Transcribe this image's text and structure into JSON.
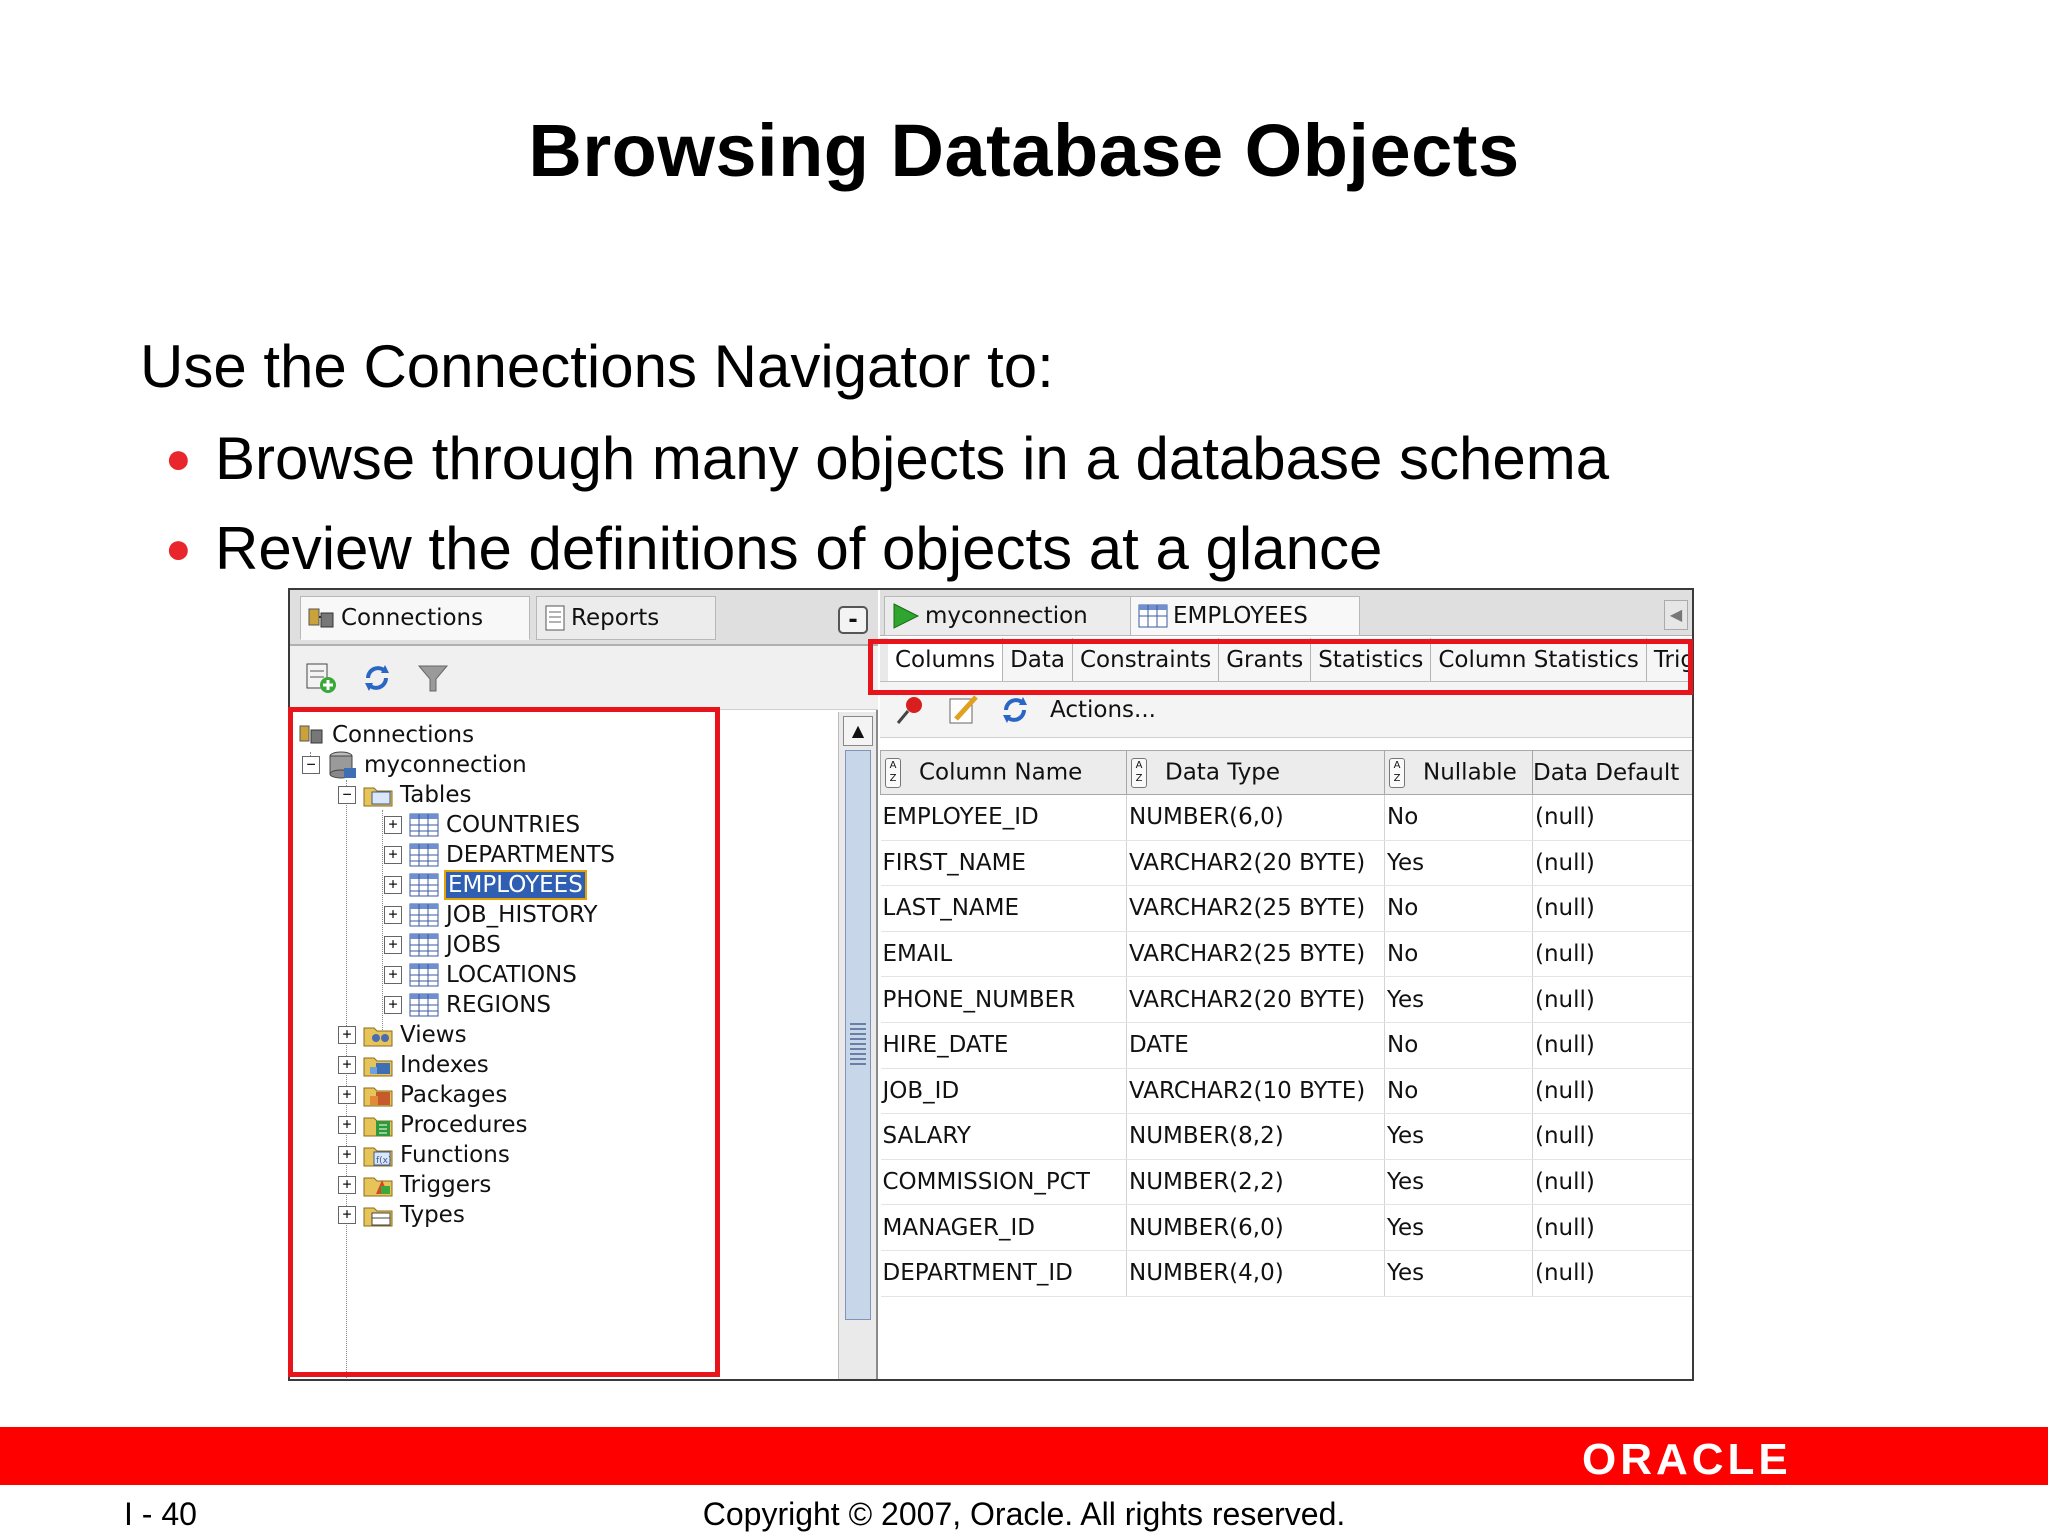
{
  "slide": {
    "title": "Browsing Database Objects",
    "intro": "Use the Connections Navigator to:",
    "bullets": [
      "Browse through many objects in a database schema",
      "Review the definitions of objects at a glance"
    ]
  },
  "left_pane": {
    "tabs": [
      "Connections",
      "Reports"
    ],
    "minimize": "-",
    "tree": {
      "root": "Connections",
      "connection": "myconnection",
      "tables_label": "Tables",
      "tables": [
        "COUNTRIES",
        "DEPARTMENTS",
        "EMPLOYEES",
        "JOB_HISTORY",
        "JOBS",
        "LOCATIONS",
        "REGIONS"
      ],
      "folders": [
        "Views",
        "Indexes",
        "Packages",
        "Procedures",
        "Functions",
        "Triggers",
        "Types"
      ]
    }
  },
  "right_pane": {
    "doc_tabs": [
      "myconnection",
      "EMPLOYEES"
    ],
    "subtabs": [
      "Columns",
      "Data",
      "Constraints",
      "Grants",
      "Statistics",
      "Column Statistics",
      "Trig"
    ],
    "actions_label": "Actions...",
    "grid": {
      "headers": [
        "Column Name",
        "Data Type",
        "Nullable",
        "Data Default"
      ],
      "rows": [
        [
          "EMPLOYEE_ID",
          "NUMBER(6,0)",
          "No",
          "(null)"
        ],
        [
          "FIRST_NAME",
          "VARCHAR2(20 BYTE)",
          "Yes",
          "(null)"
        ],
        [
          "LAST_NAME",
          "VARCHAR2(25 BYTE)",
          "No",
          "(null)"
        ],
        [
          "EMAIL",
          "VARCHAR2(25 BYTE)",
          "No",
          "(null)"
        ],
        [
          "PHONE_NUMBER",
          "VARCHAR2(20 BYTE)",
          "Yes",
          "(null)"
        ],
        [
          "HIRE_DATE",
          "DATE",
          "No",
          "(null)"
        ],
        [
          "JOB_ID",
          "VARCHAR2(10 BYTE)",
          "No",
          "(null)"
        ],
        [
          "SALARY",
          "NUMBER(8,2)",
          "Yes",
          "(null)"
        ],
        [
          "COMMISSION_PCT",
          "NUMBER(2,2)",
          "Yes",
          "(null)"
        ],
        [
          "MANAGER_ID",
          "NUMBER(6,0)",
          "Yes",
          "(null)"
        ],
        [
          "DEPARTMENT_ID",
          "NUMBER(4,0)",
          "Yes",
          "(null)"
        ]
      ]
    }
  },
  "footer": {
    "page": "I - 40",
    "copyright": "Copyright © 2007, Oracle. All rights reserved.",
    "logo": "ORACLE"
  },
  "colors": {
    "highlight": "#e8141c",
    "footer_bar": "#ff0000",
    "selection": "#2f5fb3",
    "bullet": "#e8262c"
  }
}
